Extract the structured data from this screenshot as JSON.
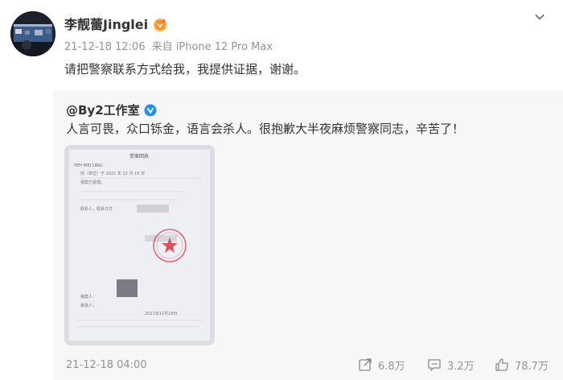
{
  "post": {
    "username": "李靓蕾Jinglei",
    "time": "21-12-18 12:06",
    "source": "来自 iPhone 12 Pro Max",
    "text": "请把警察联系方式给我，我提供证据，谢谢。"
  },
  "repost": {
    "author": "@By2工作室",
    "text": "人言可畏，众口铄金，语言会杀人。很抱歉大半夜麻烦警察同志，辛苦了！",
    "timestamp": "21-12-18 04:00",
    "document": {
      "title": "受案回执",
      "lines": [
        "PEH WEI LING：",
        "你（单位）于 2021 年 12 月 18 日",
        "报案已受理。",
        "联系人，联系方式"
      ],
      "date": "2021年12月18日"
    },
    "actions": {
      "shares": "6.8万",
      "comments": "3.2万",
      "likes": "78.7万"
    }
  },
  "colors": {
    "text": "#333333",
    "meta": "#939393",
    "repost_bg": "#f7f7f7",
    "stamp": "#d9363e"
  }
}
